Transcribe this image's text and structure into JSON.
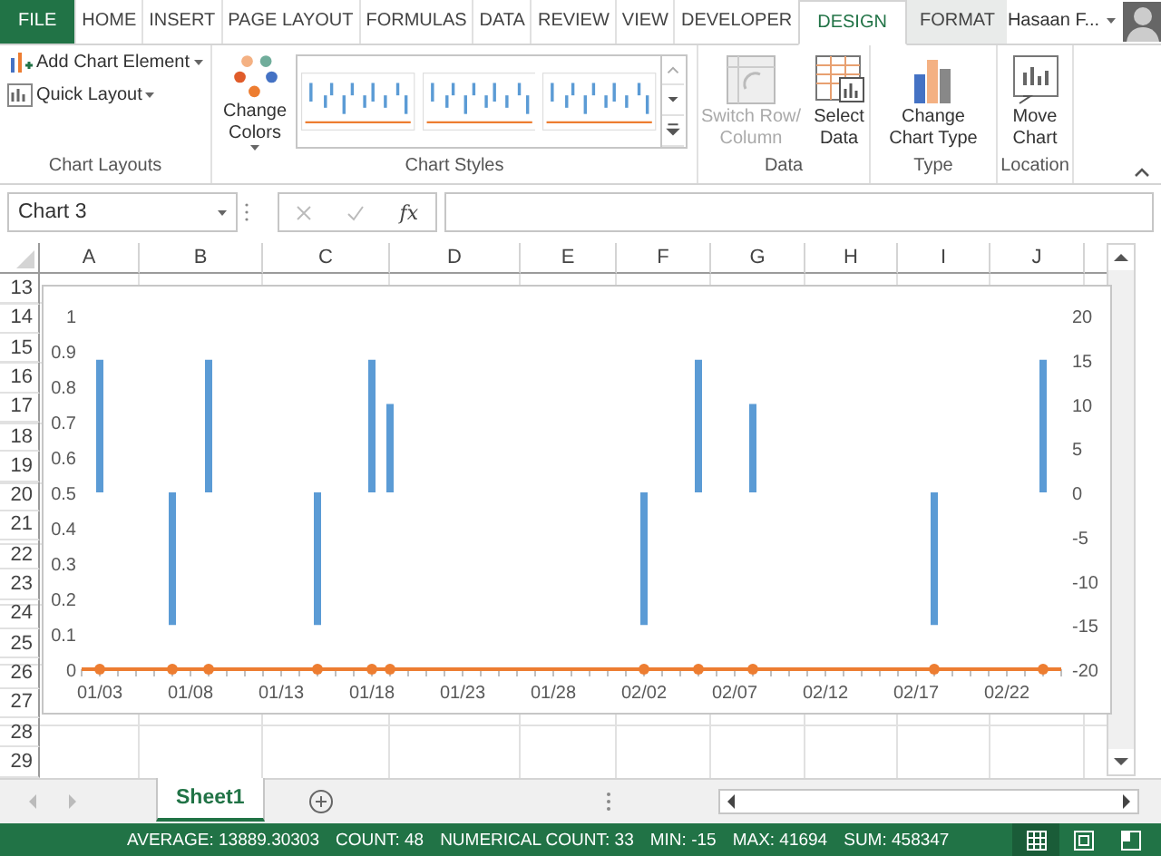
{
  "ribbon_tabs": [
    {
      "label": "FILE",
      "kind": "file",
      "selected": false
    },
    {
      "label": "HOME",
      "kind": "plain",
      "selected": false
    },
    {
      "label": "INSERT",
      "kind": "plain",
      "selected": false
    },
    {
      "label": "PAGE LAYOUT",
      "kind": "plain",
      "selected": false
    },
    {
      "label": "FORMULAS",
      "kind": "plain",
      "selected": false
    },
    {
      "label": "DATA",
      "kind": "plain",
      "selected": false
    },
    {
      "label": "REVIEW",
      "kind": "plain",
      "selected": false
    },
    {
      "label": "VIEW",
      "kind": "plain",
      "selected": false
    },
    {
      "label": "DEVELOPER",
      "kind": "plain",
      "selected": false
    },
    {
      "label": "DESIGN",
      "kind": "contextual",
      "selected": true
    },
    {
      "label": "FORMAT",
      "kind": "contextual",
      "selected": false
    }
  ],
  "user": {
    "name": "Hasaan F..."
  },
  "ribbon_groups": [
    {
      "label": "Chart Layouts",
      "kind": "small",
      "commands": [
        {
          "lines": [
            "Add Chart Element"
          ],
          "dropdown": true,
          "disabled": false
        },
        {
          "lines": [
            "Quick Layout"
          ],
          "dropdown": true,
          "disabled": false
        }
      ]
    },
    {
      "label": "Chart Styles",
      "kind": "styles",
      "commands": [
        {
          "lines": [
            "Change",
            "Colors"
          ],
          "dropdown": true,
          "disabled": false
        }
      ]
    },
    {
      "label": "Data",
      "kind": "large",
      "commands": [
        {
          "lines": [
            "Switch Row/",
            "Column"
          ],
          "dropdown": false,
          "disabled": true
        },
        {
          "lines": [
            "Select",
            "Data"
          ],
          "dropdown": false,
          "disabled": false
        }
      ]
    },
    {
      "label": "Type",
      "kind": "large",
      "commands": [
        {
          "lines": [
            "Change",
            "Chart Type"
          ],
          "dropdown": false,
          "disabled": false
        }
      ]
    },
    {
      "label": "Location",
      "kind": "large",
      "commands": [
        {
          "lines": [
            "Move",
            "Chart"
          ],
          "dropdown": false,
          "disabled": false
        }
      ]
    }
  ],
  "formula_bar": {
    "name_box": "Chart 3",
    "function_label": "fx"
  },
  "columns": [
    "A",
    "B",
    "C",
    "D",
    "E",
    "F",
    "G",
    "H",
    "I",
    "J"
  ],
  "rows": [
    "13",
    "14",
    "15",
    "16",
    "17",
    "18",
    "19",
    "20",
    "21",
    "22",
    "23",
    "24",
    "25",
    "26",
    "27",
    "28",
    "29"
  ],
  "chart": {
    "chart_data": {
      "type": "bar",
      "categories": [
        "01/03",
        null,
        null,
        null,
        null,
        "01/08",
        null,
        null,
        null,
        null,
        "01/13",
        null,
        null,
        null,
        null,
        "01/18",
        null,
        null,
        null,
        null,
        "01/23",
        null,
        null,
        null,
        null,
        "01/28",
        null,
        null,
        null,
        null,
        "02/02",
        null,
        null,
        null,
        null,
        "02/07",
        null,
        null,
        null,
        null,
        "02/12",
        null,
        null,
        null,
        null,
        "02/17",
        null,
        null,
        null,
        null,
        "02/22",
        null,
        null
      ],
      "ylim": [
        0,
        1
      ],
      "yticks": [
        {
          "value": 0,
          "label": "0"
        },
        {
          "value": 0.1,
          "label": "0.1"
        },
        {
          "value": 0.2,
          "label": "0.2"
        },
        {
          "value": 0.3,
          "label": "0.3"
        },
        {
          "value": 0.4,
          "label": "0.4"
        },
        {
          "value": 0.5,
          "label": "0.5"
        },
        {
          "value": 0.6,
          "label": "0.6"
        },
        {
          "value": 0.7,
          "label": "0.7"
        },
        {
          "value": 0.8,
          "label": "0.8"
        },
        {
          "value": 0.9,
          "label": "0.9"
        },
        {
          "value": 1,
          "label": "1"
        }
      ],
      "y2lim": [
        -20,
        20
      ],
      "y2ticks": [
        {
          "value": -20,
          "label": "-20"
        },
        {
          "value": -15,
          "label": "-15"
        },
        {
          "value": -10,
          "label": "-10"
        },
        {
          "value": -5,
          "label": "-5"
        },
        {
          "value": 0,
          "label": "0"
        },
        {
          "value": 5,
          "label": "5"
        },
        {
          "value": 10,
          "label": "10"
        },
        {
          "value": 15,
          "label": "15"
        },
        {
          "value": 20,
          "label": "20"
        }
      ],
      "series": [
        {
          "axis": "y2",
          "color": "#5b9bd5",
          "values": [
            15,
            null,
            null,
            null,
            -15,
            null,
            15,
            null,
            null,
            null,
            null,
            null,
            -15,
            null,
            null,
            15,
            10,
            null,
            null,
            null,
            null,
            null,
            null,
            null,
            null,
            null,
            null,
            null,
            null,
            null,
            -15,
            null,
            null,
            15,
            null,
            null,
            10,
            null,
            null,
            null,
            null,
            null,
            null,
            null,
            null,
            null,
            -15,
            null,
            null,
            null,
            null,
            null,
            15
          ]
        },
        {
          "color": "#ed7d31",
          "values": [
            0,
            null,
            null,
            null,
            0,
            null,
            0,
            null,
            null,
            null,
            null,
            null,
            0,
            null,
            null,
            0,
            0,
            null,
            null,
            null,
            null,
            null,
            null,
            null,
            null,
            null,
            null,
            null,
            null,
            null,
            0,
            null,
            null,
            0,
            null,
            null,
            0,
            null,
            null,
            null,
            null,
            null,
            null,
            null,
            null,
            null,
            0,
            null,
            null,
            null,
            null,
            null,
            0
          ]
        }
      ]
    }
  },
  "sheet_tabs": [
    {
      "label": "Sheet1",
      "selected": true
    }
  ],
  "status_bar": [
    "AVERAGE: 13889.30303",
    "COUNT: 48",
    "NUMERICAL COUNT: 33",
    "MIN: -15",
    "MAX: 41694",
    "SUM: 458347"
  ]
}
